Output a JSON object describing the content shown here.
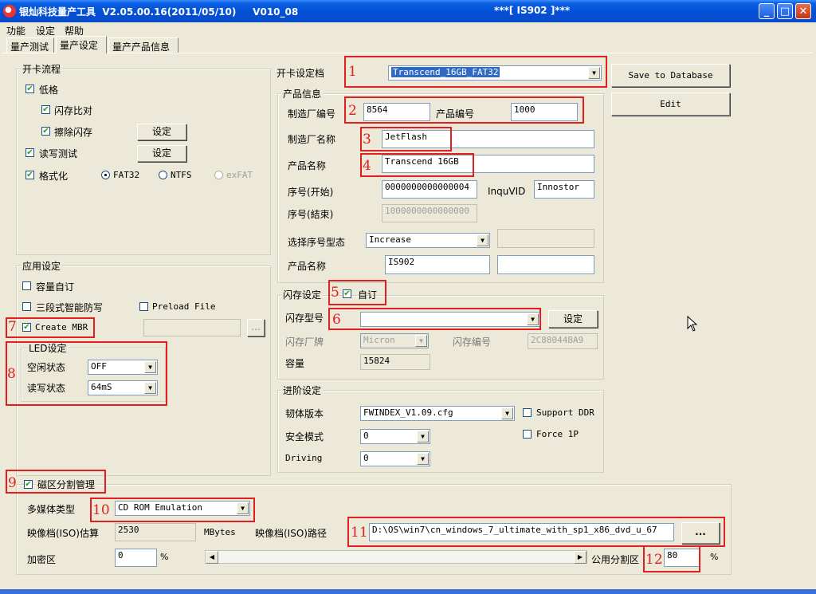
{
  "window": {
    "title": "银灿科技量产工具  V2.05.00.16(2011/05/10)     V010_08",
    "center_title": "***[ IS902 ]***",
    "controls": {
      "minimize": "_",
      "maximize": "□",
      "close": "✕"
    }
  },
  "menu": [
    "功能",
    "设定",
    "帮助"
  ],
  "tabs": [
    "量产测试",
    "量产设定",
    "量产产品信息"
  ],
  "open_card_flow": {
    "title": "开卡流程",
    "low_format": "低格",
    "flash_compare": "闪存比对",
    "erase_flash": "擦除闪存",
    "rw_test": "读写测试",
    "format": "格式化",
    "setting_btn": "设定",
    "fs": [
      "FAT32",
      "NTFS",
      "exFAT"
    ]
  },
  "app_settings": {
    "title": "应用设定",
    "custom_capacity": "容量自订",
    "three_stage": "三段式智能防写",
    "preload_file": "Preload File",
    "create_mbr": "Create MBR",
    "browse_btn": "..."
  },
  "led": {
    "title": "LED设定",
    "idle_label": "空闲状态",
    "idle_value": "OFF",
    "rw_label": "读写状态",
    "rw_value": "64mS"
  },
  "profile": {
    "label": "开卡设定档",
    "value": "Transcend_16GB_FAT32",
    "save_btn": "Save to Database",
    "edit_btn": "Edit"
  },
  "product_info": {
    "title": "产品信息",
    "vendor_id_label": "制造厂编号",
    "vendor_id": "8564",
    "product_id_label": "产品编号",
    "product_id": "1000",
    "vendor_name_label": "制造厂名称",
    "vendor_name": "JetFlash",
    "product_name_label": "产品名称",
    "product_name": "Transcend 16GB",
    "serial_start_label": "序号(开始)",
    "serial_start": "0000000000000004",
    "inqu_vid_label": "InquVID",
    "inqu_vid": "Innostor",
    "serial_end_label": "序号(結束)",
    "serial_end": "1000000000000000",
    "serial_type_label": "选择序号型态",
    "serial_type": "Increase",
    "product_name2_label": "产品名称",
    "product_name2": "IS902"
  },
  "flash": {
    "title": "闪存设定",
    "custom": "自订",
    "model_label": "闪存型号",
    "model_value": "",
    "setting_btn": "设定",
    "brand_label": "闪存厂牌",
    "brand_value": "Micron",
    "code_label": "闪存编号",
    "code_value": "2C88044BA9",
    "capacity_label": "容量",
    "capacity_value": "15824"
  },
  "advanced": {
    "title": "进阶设定",
    "firmware_label": "韧体版本",
    "firmware_value": "FWINDEX_V1.09.cfg",
    "support_ddr": "Support DDR",
    "security_label": "安全模式",
    "security_value": "0",
    "force_1p": "Force 1P",
    "driving_label": "Driving",
    "driving_value": "0"
  },
  "partition": {
    "title": "磁区分割管理",
    "media_label": "多媒体类型",
    "media_value": "CD ROM Emulation",
    "iso_est_label": "映像档(ISO)估算",
    "iso_est_value": "2530",
    "iso_unit": "MBytes",
    "iso_path_label": "映像档(ISO)路径",
    "iso_path_value": "D:\\OS\\win7\\cn_windows_7_ultimate_with_sp1_x86_dvd_u_67",
    "browse_btn": "...",
    "encrypt_label": "加密区",
    "encrypt_value": "0",
    "percent": "%",
    "public_label": "公用分割区",
    "public_value": "80"
  },
  "annotations": [
    "1",
    "2",
    "3",
    "4",
    "5",
    "6",
    "7",
    "8",
    "9",
    "10",
    "11",
    "12"
  ]
}
